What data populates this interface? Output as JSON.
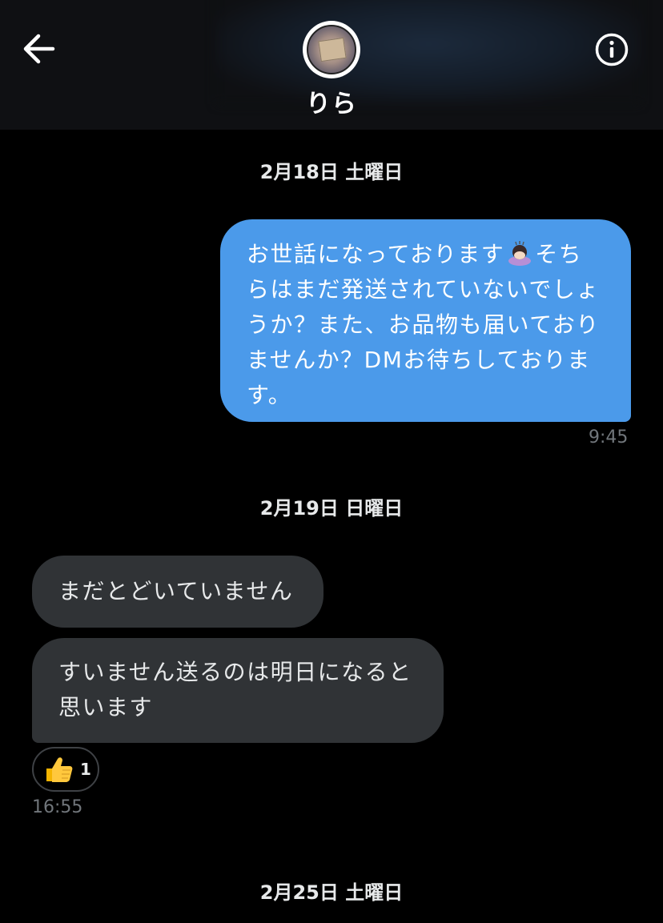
{
  "header": {
    "contact_name": "りら"
  },
  "conversation": {
    "sections": [
      {
        "date": "2月18日 土曜日",
        "messages": [
          {
            "direction": "outgoing",
            "text_before_emoji": "お世話になっております",
            "emoji": "person-bowing-emoji",
            "text_after_emoji_line1": "そち",
            "lines": [
              "らはまだ発送されていないでしょ",
              "うか？また、お品物も届いており",
              "ませんか？DMお待ちしておりま",
              "す。"
            ],
            "time": "9:45"
          }
        ]
      },
      {
        "date": "2月19日 日曜日",
        "messages": [
          {
            "direction": "incoming",
            "lines": [
              "まだとどいていません"
            ]
          },
          {
            "direction": "incoming",
            "lines": [
              "すいません送るのは明日になると",
              "思います"
            ],
            "reaction": {
              "emoji": "thumbs-up-emoji",
              "count": "1"
            },
            "time": "16:55"
          }
        ]
      },
      {
        "date": "2月25日 土曜日",
        "messages": []
      }
    ]
  },
  "colors": {
    "outgoing_bubble": "#4b9aea",
    "incoming_bubble": "#303336",
    "timestamp": "#71767b",
    "background": "#000000"
  }
}
